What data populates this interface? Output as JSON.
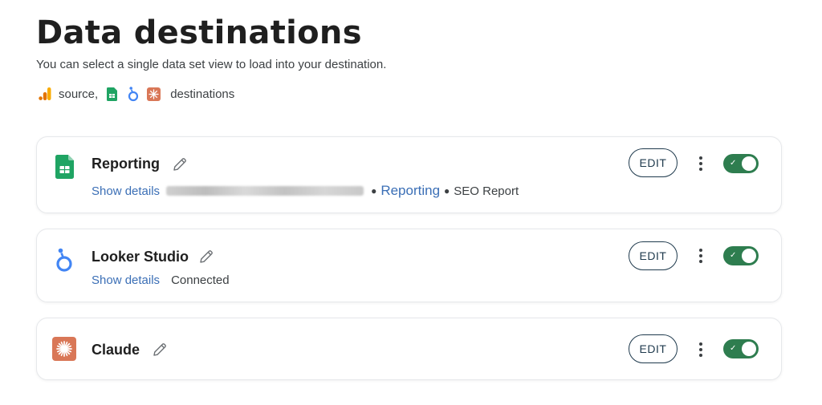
{
  "header": {
    "title": "Data destinations",
    "subtitle": "You can select a single data set view to load into your destination.",
    "legend_source": "source,",
    "legend_destinations": "destinations"
  },
  "icons": {
    "analytics": "google-analytics-icon",
    "sheets": "google-sheets-icon",
    "looker": "looker-studio-icon",
    "claude": "claude-icon",
    "edit": "pencil-icon",
    "menu": "more-vert-icon",
    "toggle_check": "✓"
  },
  "colors": {
    "toggle_on": "#2e7d4f",
    "link": "#3b6fb6",
    "sheets_green": "#1fa463",
    "looker_blue": "#4285f4",
    "claude_orange": "#d97757",
    "analytics_orange": "#f9ab00"
  },
  "destinations": [
    {
      "name": "Reporting",
      "show_details": "Show details",
      "detail_link": "Reporting",
      "detail_extra": "SEO Report",
      "edit_label": "EDIT",
      "enabled": true
    },
    {
      "name": "Looker Studio",
      "show_details": "Show details",
      "status": "Connected",
      "edit_label": "EDIT",
      "enabled": true
    },
    {
      "name": "Claude",
      "edit_label": "EDIT",
      "enabled": true
    }
  ]
}
